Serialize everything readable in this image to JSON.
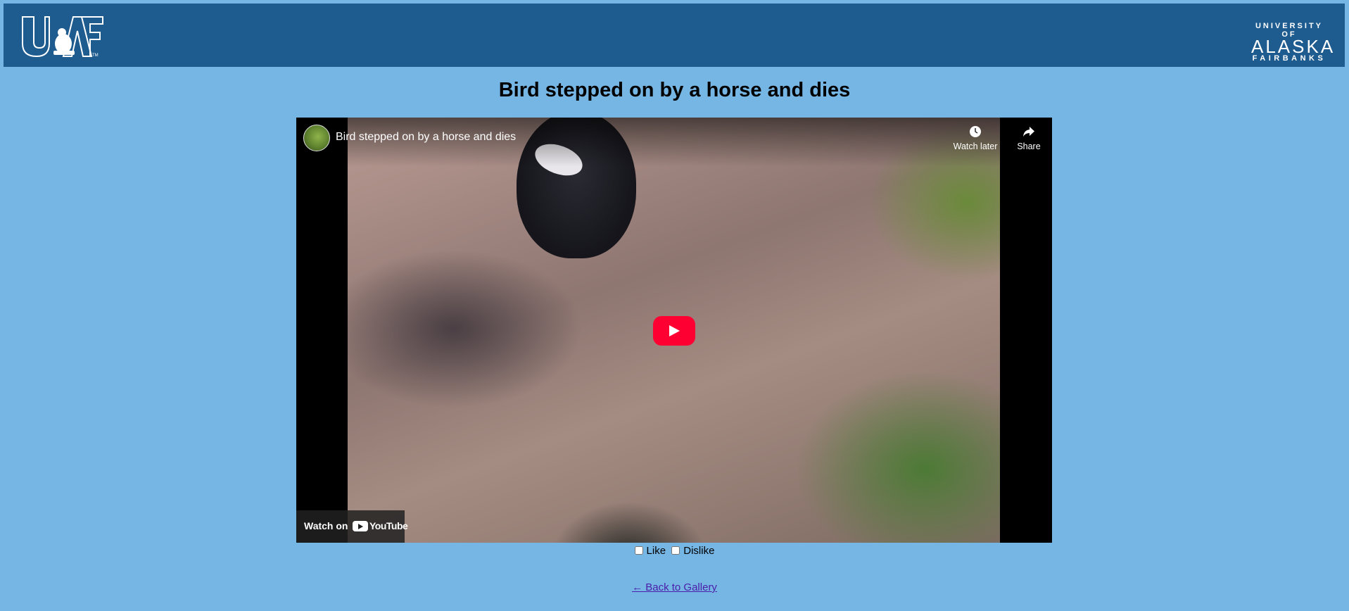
{
  "header": {
    "left_logo": "UAF",
    "right_logo": {
      "line1": "UNIVERSITY OF",
      "line2": "ALASKA",
      "line3": "FAIRBANKS"
    },
    "bg_color": "#1e5b8f"
  },
  "page": {
    "title": "Bird stepped on by a horse and dies",
    "bg_color": "#76b6e5"
  },
  "video": {
    "title": "Bird stepped on by a horse and dies",
    "watch_later_label": "Watch later",
    "share_label": "Share",
    "watch_on_label": "Watch on",
    "youtube_brand": "YouTube",
    "play_color": "#ff0033"
  },
  "votes": {
    "like_label": "Like",
    "dislike_label": "Dislike",
    "like_checked": false,
    "dislike_checked": false
  },
  "back_link": {
    "label": "← Back to Gallery"
  }
}
